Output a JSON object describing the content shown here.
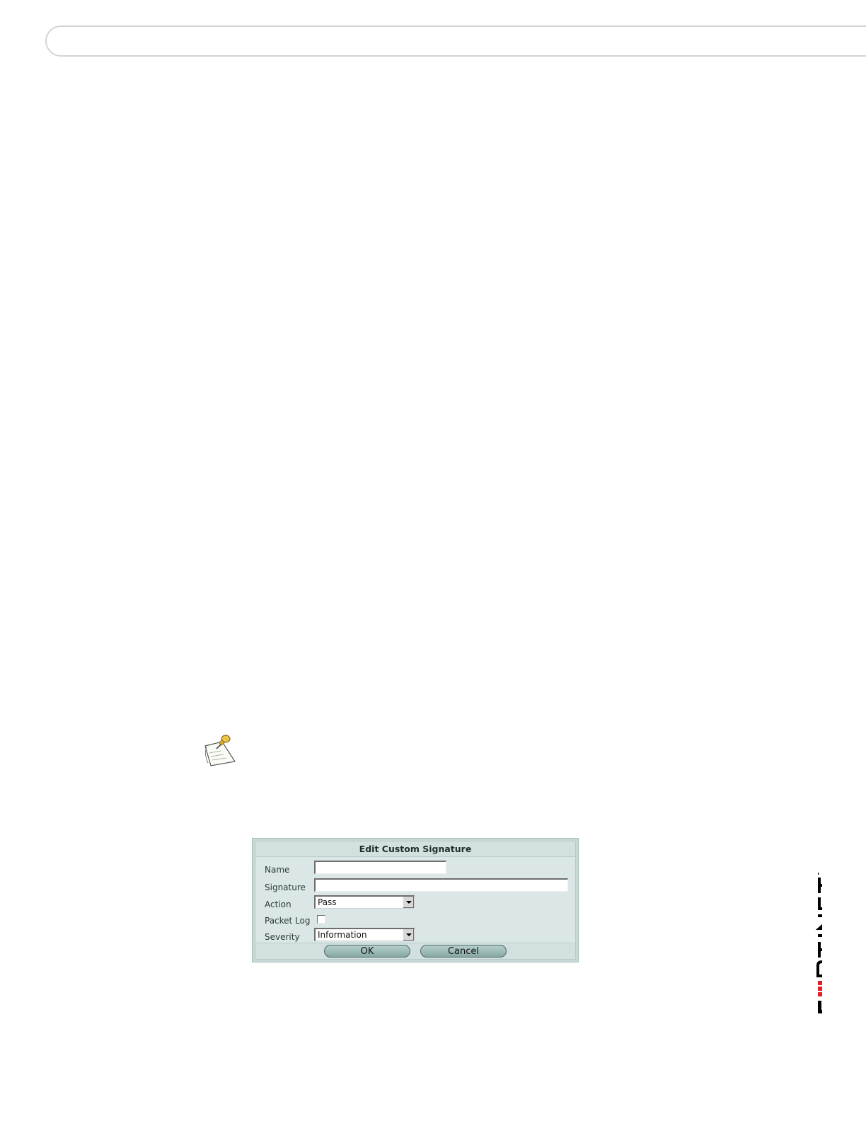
{
  "dialog": {
    "title": "Edit Custom Signature",
    "fields": {
      "name_label": "Name",
      "signature_label": "Signature",
      "action_label": "Action",
      "action_value": "Pass",
      "packet_log_label": "Packet Log",
      "packet_log_checked": false,
      "severity_label": "Severity",
      "severity_value": "Information"
    },
    "buttons": {
      "ok": "OK",
      "cancel": "Cancel"
    }
  },
  "logo": {
    "text": "FORTINET",
    "accent_color": "#e21e26"
  },
  "icons": [
    "note-icon"
  ]
}
